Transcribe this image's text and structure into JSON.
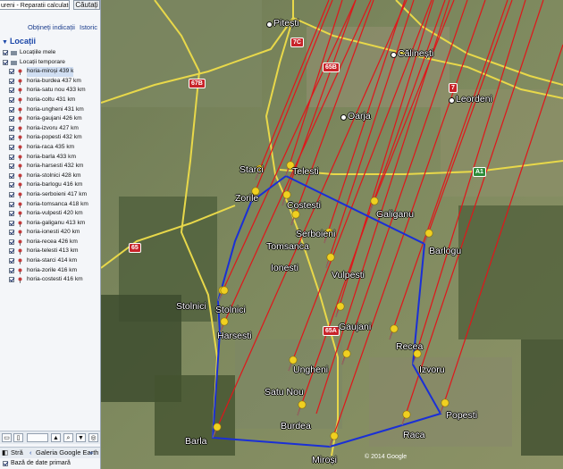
{
  "search": {
    "query": "ureni - Reparatii calculatoare, Bucuresti",
    "button": "Căutați"
  },
  "links": {
    "directions": "Obțineți indicații",
    "history": "Istoric"
  },
  "locations": {
    "header": "Locații",
    "my_places": "Locațiile mele",
    "temporary": "Locații temporare",
    "items": [
      "horia-miroși 439 k",
      "horia-burdea 437 km",
      "horia-satu nou 433 km",
      "horia-coltu 431 km",
      "horia-ungheni 431 km",
      "horia-gaujani 426 km",
      "horia-izvoru 427 km",
      "horia-popesti 432 km",
      "horia-raca 435 km",
      "horia-barla 433 km",
      "horia-harsesti 432 km",
      "horia-stolnici 428 km",
      "horia-barlogu 416 km",
      "horia-serboieni 417 km",
      "horia-tomsanca 418 km",
      "horia-vulpesti 420 km",
      "horia-galiganu 413 km",
      "horia-ionesti 420 km",
      "horia-recea 426 km",
      "horia-telesti 413 km",
      "horia-starci 414 km",
      "horia-zorile 416 km",
      "horia-costesti 416 km"
    ]
  },
  "toolbar": {
    "zoom_in": "+",
    "zoom_out": "-",
    "arrow_up": "▲",
    "arrow_down": "▼"
  },
  "tabs": {
    "search_tab": "Stră",
    "gallery_tab": "Galeria Google Earth",
    "more": "»"
  },
  "layers": {
    "primary_db": "Bază de date primară"
  },
  "map": {
    "towns": [
      {
        "name": "Pitești"
      },
      {
        "name": "Călinești"
      },
      {
        "name": "Leordeni"
      },
      {
        "name": "Oarja"
      }
    ],
    "pins": [
      {
        "name": "Starci"
      },
      {
        "name": "Telesti"
      },
      {
        "name": "Zorile"
      },
      {
        "name": "Costesti"
      },
      {
        "name": "Galiganu"
      },
      {
        "name": "Serboieni"
      },
      {
        "name": "Tomsanca"
      },
      {
        "name": "Barlogu"
      },
      {
        "name": "Ionesti"
      },
      {
        "name": "Vulpesti"
      },
      {
        "name": "Stolnici"
      },
      {
        "name": "Stolnici"
      },
      {
        "name": "Gaujani"
      },
      {
        "name": "Harsesti"
      },
      {
        "name": "Recea"
      },
      {
        "name": "Izvoru"
      },
      {
        "name": "Ungheni"
      },
      {
        "name": "Satu Nou"
      },
      {
        "name": "Popesti"
      },
      {
        "name": "Burdea"
      },
      {
        "name": "Raca"
      },
      {
        "name": "Barla"
      },
      {
        "name": "Miroși"
      }
    ],
    "road_shields": [
      "7C",
      "65B",
      "7",
      "67B",
      "A1",
      "65",
      "65A"
    ],
    "copyright": "© 2014 Google"
  },
  "colors": {
    "boundary": "#1a2fd6",
    "rays": "#e0161a",
    "roads": "#e8d84a",
    "pins": "#f0d020"
  }
}
